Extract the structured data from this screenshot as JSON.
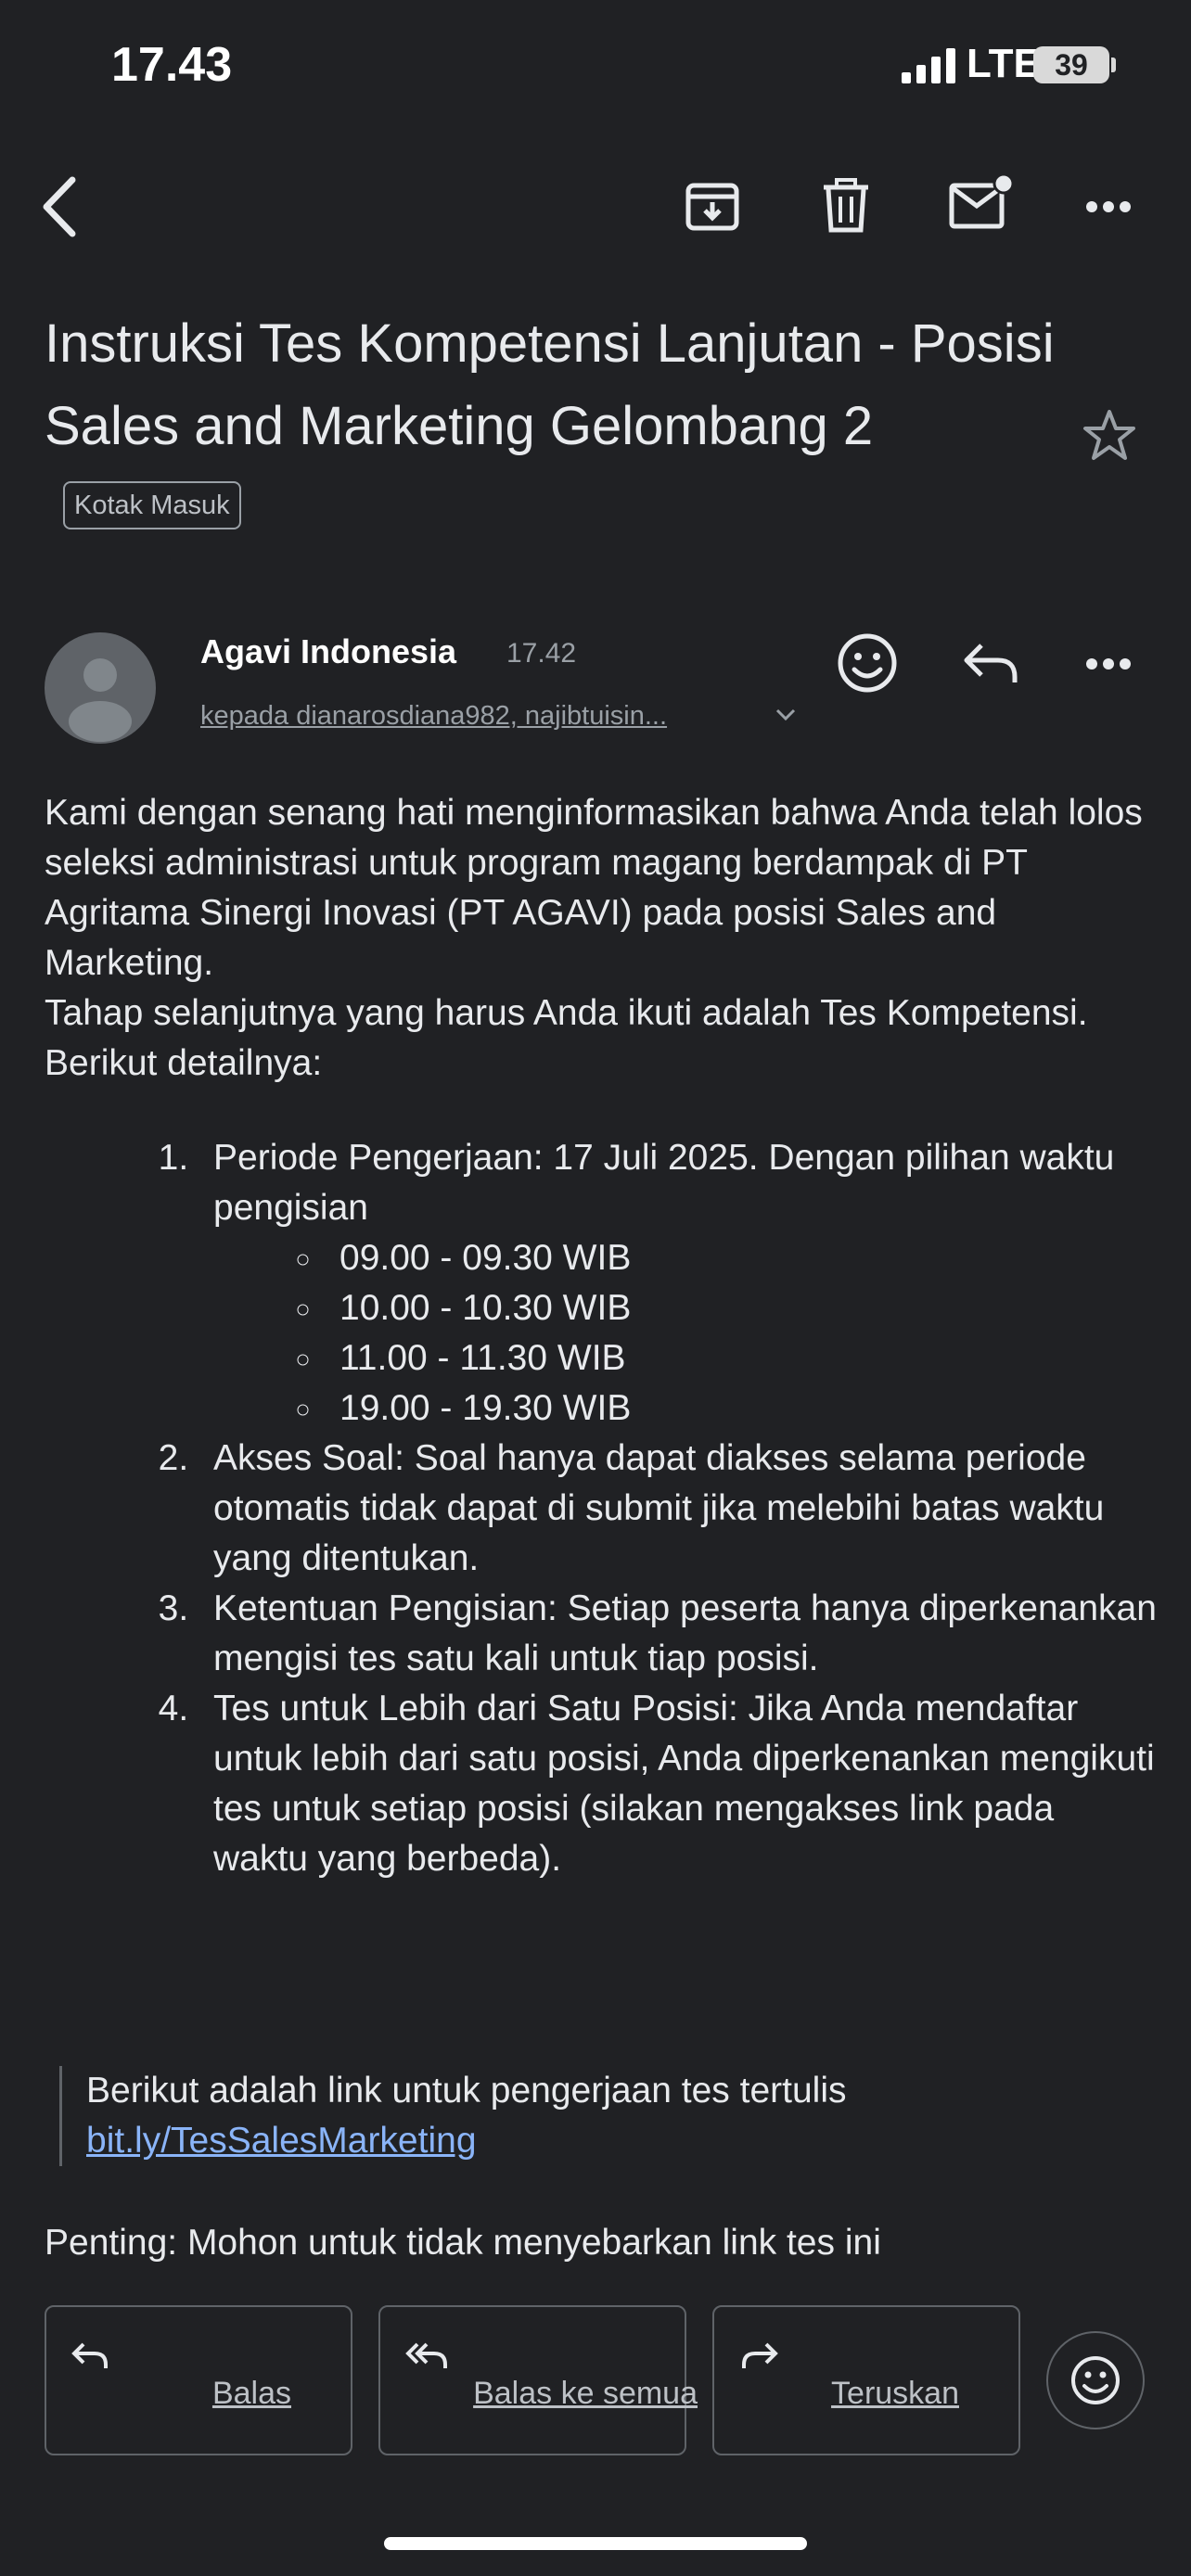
{
  "status_bar": {
    "time": "17.43",
    "network": "LTE",
    "battery": "39"
  },
  "toolbar": {
    "icons": [
      "back-icon",
      "archive-icon",
      "trash-icon",
      "mark-unread-icon",
      "more-icon"
    ]
  },
  "email": {
    "subject": "Instruksi Tes Kompetensi Lanjutan - Posisi Sales and Marketing Gelombang 2",
    "label": "Kotak Masuk",
    "sender": "Agavi Indonesia",
    "time": "17.42",
    "recipients": "kepada dianarosdiana982, najibtuisin..."
  },
  "body": {
    "intro": " Kami dengan senang hati menginformasikan bahwa Anda telah lolos seleksi administrasi untuk program magang berdampak di PT Agritama Sinergi Inovasi (PT AGAVI) pada posisi Sales and Marketing.",
    "intro2": "Tahap selanjutnya yang harus Anda ikuti adalah Tes Kompetensi. Berikut detailnya:",
    "items": [
      "Periode Pengerjaan: 17 Juli 2025. Dengan pilihan waktu pengisian",
      "Akses Soal: Soal hanya dapat diakses selama periode otomatis tidak dapat di submit jika melebihi batas waktu yang ditentukan.",
      "Ketentuan Pengisian: Setiap peserta hanya diperkenankan mengisi tes satu kali untuk tiap posisi.",
      "Tes untuk Lebih dari Satu Posisi: Jika Anda mendaftar untuk lebih dari satu posisi, Anda diperkenankan mengikuti tes untuk setiap posisi (silakan mengakses link pada waktu yang berbeda)."
    ],
    "times": [
      "09.00 - 09.30 WIB",
      "10.00 - 10.30 WIB",
      "11.00 - 11.30 WIB",
      "19.00 - 19.30 WIB"
    ],
    "link_intro": "Berikut adalah link untuk pengerjaan tes tertulis ",
    "link_text": "bit.ly/TesSalesMarketing",
    "note": "Penting: Mohon untuk tidak menyebarkan link tes ini"
  },
  "actions": {
    "reply": "Balas",
    "reply_all": "Balas ke semua",
    "forward": "Teruskan"
  }
}
